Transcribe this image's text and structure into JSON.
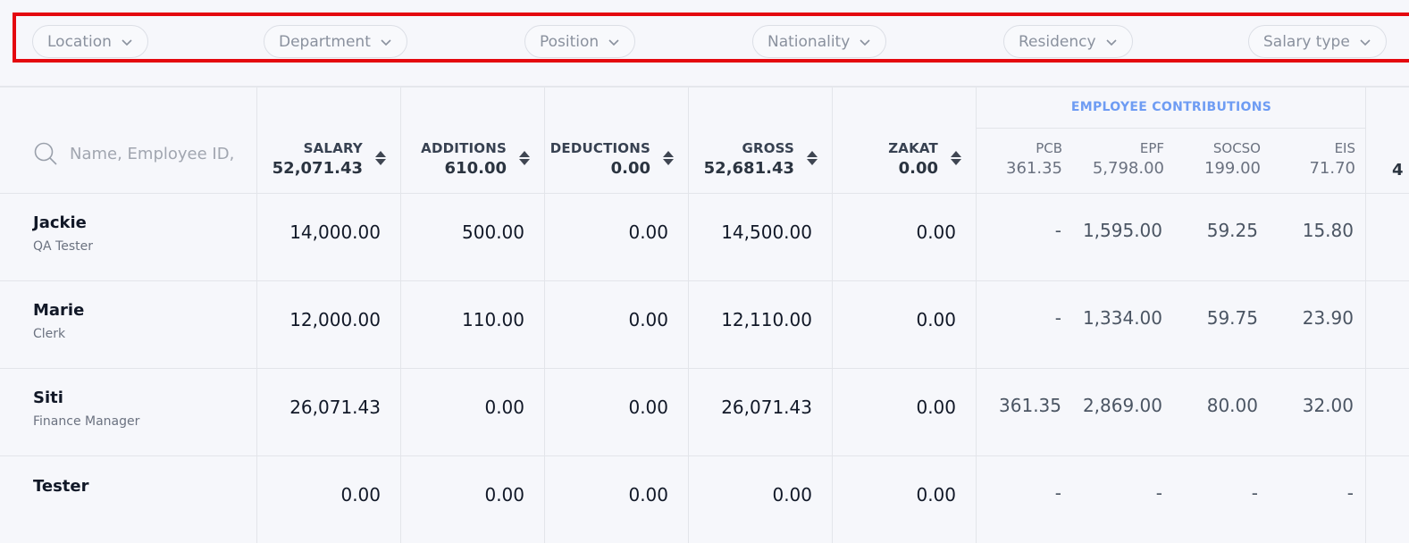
{
  "filters": [
    {
      "label": "Location"
    },
    {
      "label": "Department"
    },
    {
      "label": "Position"
    },
    {
      "label": "Nationality"
    },
    {
      "label": "Residency"
    },
    {
      "label": "Salary type"
    }
  ],
  "search": {
    "placeholder": "Name, Employee ID, F"
  },
  "columns": [
    {
      "label": "SALARY",
      "total": "52,071.43"
    },
    {
      "label": "ADDITIONS",
      "total": "610.00"
    },
    {
      "label": "DEDUCTIONS",
      "total": "0.00"
    },
    {
      "label": "GROSS",
      "total": "52,681.43"
    },
    {
      "label": "ZAKAT",
      "total": "0.00"
    }
  ],
  "employee_contributions": {
    "title": "EMPLOYEE CONTRIBUTIONS",
    "columns": [
      {
        "label": "PCB",
        "total": "361.35"
      },
      {
        "label": "EPF",
        "total": "5,798.00"
      },
      {
        "label": "SOCSO",
        "total": "199.00"
      },
      {
        "label": "EIS",
        "total": "71.70"
      }
    ]
  },
  "edge_total": "4",
  "rows": [
    {
      "name": "Jackie",
      "position": "QA Tester",
      "salary": "14,000.00",
      "additions": "500.00",
      "deductions": "0.00",
      "gross": "14,500.00",
      "zakat": "0.00",
      "pcb": "-",
      "epf": "1,595.00",
      "socso": "59.25",
      "eis": "15.80"
    },
    {
      "name": "Marie",
      "position": "Clerk",
      "salary": "12,000.00",
      "additions": "110.00",
      "deductions": "0.00",
      "gross": "12,110.00",
      "zakat": "0.00",
      "pcb": "-",
      "epf": "1,334.00",
      "socso": "59.75",
      "eis": "23.90"
    },
    {
      "name": "Siti",
      "position": "Finance Manager",
      "salary": "26,071.43",
      "additions": "0.00",
      "deductions": "0.00",
      "gross": "26,071.43",
      "zakat": "0.00",
      "pcb": "361.35",
      "epf": "2,869.00",
      "socso": "80.00",
      "eis": "32.00"
    },
    {
      "name": "Tester",
      "position": "",
      "salary": "0.00",
      "additions": "0.00",
      "deductions": "0.00",
      "gross": "0.00",
      "zakat": "0.00",
      "pcb": "-",
      "epf": "-",
      "socso": "-",
      "eis": "-"
    }
  ],
  "colors": {
    "highlight_border": "#e4080f",
    "group_title": "#6e9cf3"
  }
}
